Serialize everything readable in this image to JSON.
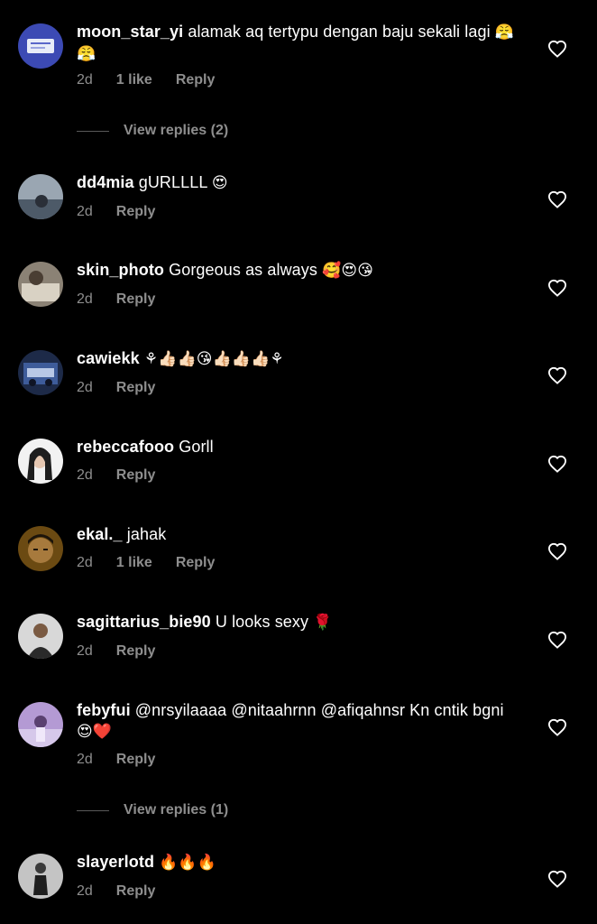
{
  "comments": [
    {
      "user": "moon_star_yi",
      "text": " alamak aq tertypu dengan baju sekali lagi ",
      "emoji": "😤😤",
      "time": "2d",
      "likes": "1 like",
      "reply": "Reply"
    },
    {
      "user": "dd4mia",
      "text": " gURLLLL ",
      "emoji": "😍",
      "time": "2d",
      "likes": "",
      "reply": "Reply"
    },
    {
      "user": "skin_photo",
      "text": " Gorgeous as always ",
      "emoji": "🥰😍😘",
      "time": "2d",
      "likes": "",
      "reply": "Reply"
    },
    {
      "user": "cawiekk",
      "text": " ",
      "emoji": "⚘👍🏻👍🏻😘👍🏻👍🏻👍🏻⚘",
      "time": "2d",
      "likes": "",
      "reply": "Reply"
    },
    {
      "user": "rebeccafooo",
      "text": " Gorll",
      "emoji": "",
      "time": "2d",
      "likes": "",
      "reply": "Reply"
    },
    {
      "user": "ekal._",
      "text": " jahak",
      "emoji": "",
      "time": "2d",
      "likes": "1 like",
      "reply": "Reply"
    },
    {
      "user": "sagittarius_bie90",
      "text": " U looks sexy ",
      "emoji": "🌹",
      "time": "2d",
      "likes": "",
      "reply": "Reply"
    },
    {
      "user": "febyfui",
      "text": " @nrsyilaaaa @nitaahrnn @afiqahnsr Kn cntik bgni",
      "emoji": "😍❤️",
      "time": "2d",
      "likes": "",
      "reply": "Reply"
    },
    {
      "user": "slayerlotd",
      "text": " ",
      "emoji": "🔥🔥🔥",
      "time": "2d",
      "likes": "",
      "reply": "Reply"
    }
  ],
  "view_replies": [
    {
      "label": "View replies (2)"
    },
    {
      "label": "View replies (1)"
    }
  ],
  "colors": {
    "background": "#000000",
    "text": "#ffffff",
    "secondary": "#8e8e8e"
  },
  "icons": {
    "like": "heart-outline-icon"
  }
}
